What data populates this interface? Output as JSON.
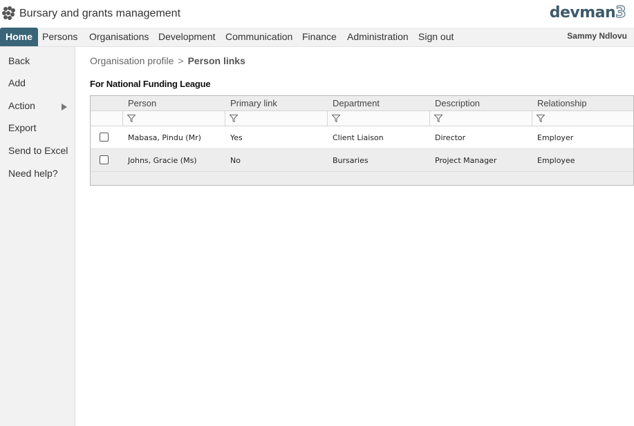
{
  "app": {
    "title": "Bursary and grants management",
    "brand_text": "devman",
    "brand_num": "3",
    "brand_color": "#3d5a6a"
  },
  "nav": {
    "items": [
      "Home",
      "Persons",
      "Organisations",
      "Development",
      "Communication",
      "Finance",
      "Administration",
      "Sign out"
    ],
    "active_index": 0,
    "user": "Sammy Ndlovu",
    "active_color": "#3a6477"
  },
  "sidebar": {
    "items": [
      "Back",
      "Add",
      "Action",
      "Export",
      "Send to Excel",
      "Need help?"
    ],
    "action_icon": "triangle-right-icon"
  },
  "breadcrumb": {
    "parent": "Organisation profile",
    "separator": ">",
    "current": "Person links"
  },
  "org": {
    "title": "For National Funding League"
  },
  "table": {
    "columns": [
      "Person",
      "Primary link",
      "Department",
      "Description",
      "Relationship"
    ],
    "filter_icon": "filter-icon",
    "rows": [
      [
        "Mabasa, Pindu (Mr)",
        "Yes",
        "Client Liaison",
        "Director",
        "Employer"
      ],
      [
        "Johns, Gracie (Ms)",
        "No",
        "Bursaries",
        "Project Manager",
        "Employee"
      ]
    ]
  }
}
